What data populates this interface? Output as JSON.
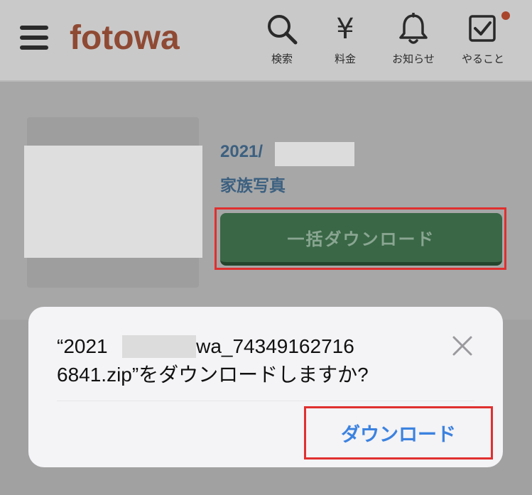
{
  "header": {
    "logo": "fotowa",
    "nav": [
      {
        "label": "検索",
        "icon": "search-icon"
      },
      {
        "label": "料金",
        "icon": "yen-icon",
        "glyph": "¥"
      },
      {
        "label": "お知らせ",
        "icon": "bell-icon"
      },
      {
        "label": "やること",
        "icon": "checkbox-icon",
        "has_badge": true
      }
    ]
  },
  "album": {
    "date": "2021/",
    "title": "家族写真",
    "bulk_download_label": "一括ダウンロード"
  },
  "dialog": {
    "message": "“2021_fotowa_74349162716 6841.zip”をダウンロードしますか?",
    "message_line1": "“2021        _fotowa_74349162716",
    "message_line2": "6841.zip”をダウンロードしますか?",
    "download_label": "ダウンロード"
  },
  "colors": {
    "logo": "#8f4a34",
    "badge": "#a9452a",
    "bulk_button": "#3a6746",
    "link_blue": "#3b82e0",
    "highlight_red": "#e0302f"
  }
}
